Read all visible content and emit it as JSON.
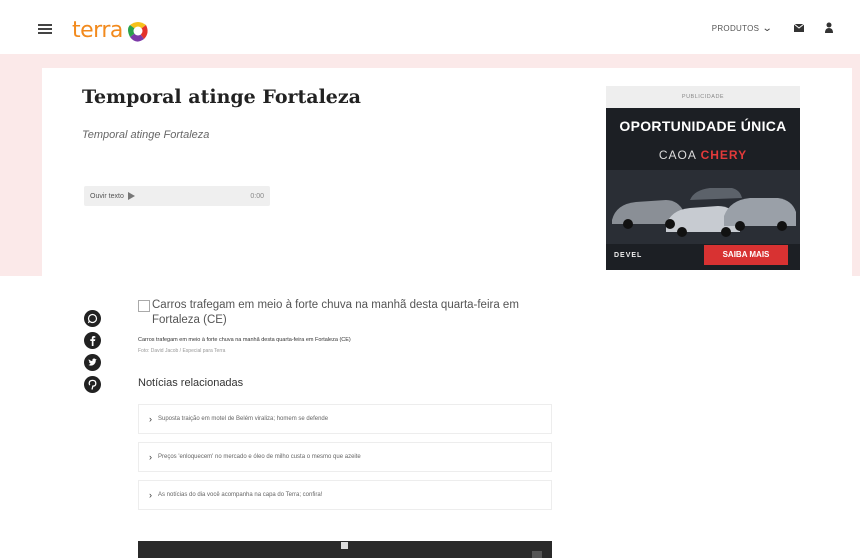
{
  "header": {
    "logo_text": "terra",
    "nav_produtos": "PRODUTOS",
    "icons": [
      "menu-icon",
      "chevron-down-icon",
      "mail-icon",
      "user-icon"
    ]
  },
  "article": {
    "title": "Temporal atinge Fortaleza",
    "subtitle": "Temporal atinge Fortaleza",
    "audio": {
      "label": "Ouvir texto",
      "time": "0:00"
    },
    "image_alt": "Carros trafegam em meio à forte chuva na manhã desta quarta-feira em Fortaleza (CE)",
    "caption": "Carros trafegam em meio à forte chuva na manhã desta quarta-feira em Fortaleza (CE)",
    "credit": "Foto: David Jacob / Especial para Terra"
  },
  "ad": {
    "label": "PUBLICIDADE",
    "headline": "OPORTUNIDADE ÚNICA",
    "brand_prefix": "CAOA",
    "brand_suffix": "CHERY",
    "cta": "SAIBA MAIS",
    "dealer": "DEVEL"
  },
  "share": [
    "whatsapp-icon",
    "facebook-icon",
    "twitter-icon",
    "pinterest-icon"
  ],
  "related": {
    "title": "Notícias relacionadas",
    "items": [
      "Suposta traição em motel de Belém viraliza; homem se defende",
      "Preços 'enloquecem' no mercado e óleo de milho custa o mesmo que azeite",
      "As notícias do dia você acompanha na capa do Terra; confira!"
    ]
  },
  "colors": {
    "logo": "#f28a1d",
    "band": "#fbe9e9",
    "ad_cta": "#d83232"
  }
}
